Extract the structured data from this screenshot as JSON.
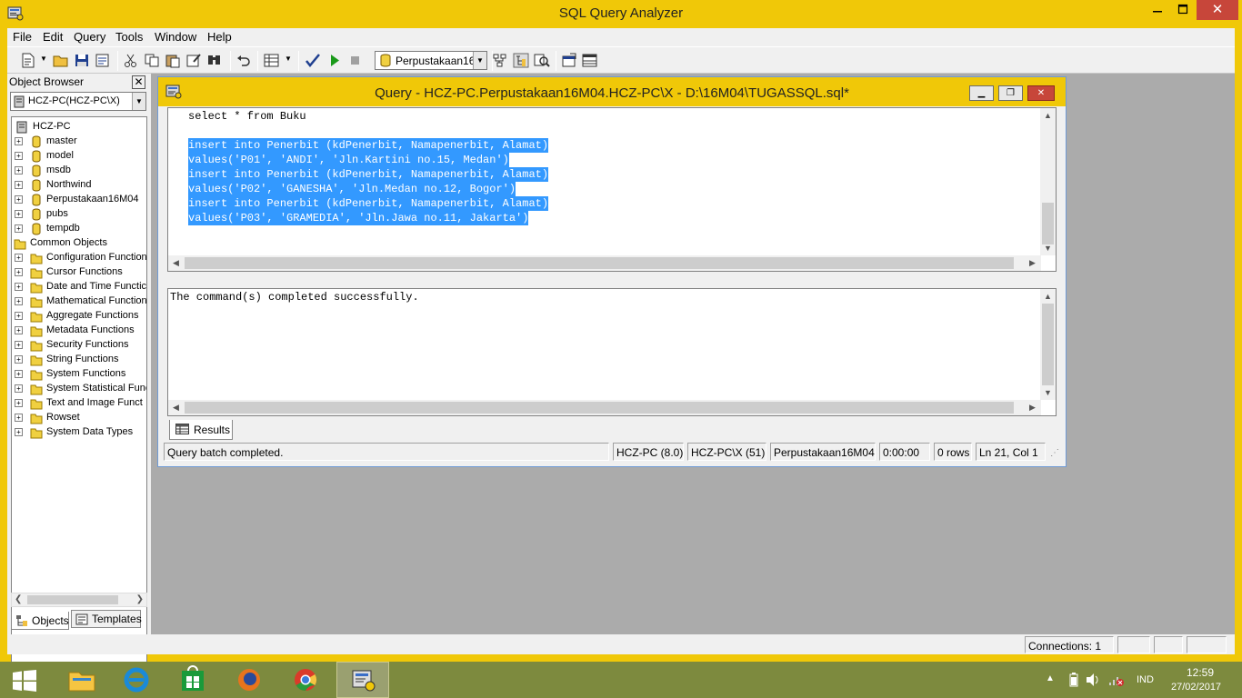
{
  "app": {
    "title": "SQL Query Analyzer"
  },
  "menu": {
    "items": [
      "File",
      "Edit",
      "Query",
      "Tools",
      "Window",
      "Help"
    ]
  },
  "toolbar": {
    "database": "Perpustakaan16"
  },
  "object_browser": {
    "title": "Object Browser",
    "close": "✕",
    "server_selector": "HCZ-PC(HCZ-PC\\X)",
    "root": "HCZ-PC",
    "databases": [
      "master",
      "model",
      "msdb",
      "Northwind",
      "Perpustakaan16M04",
      "pubs",
      "tempdb"
    ],
    "common_objects": "Common Objects",
    "function_groups": [
      "Configuration Function",
      "Cursor Functions",
      "Date and Time Functic",
      "Mathematical Function",
      "Aggregate Functions",
      "Metadata Functions",
      "Security Functions",
      "String Functions",
      "System Functions",
      "System Statistical Func",
      "Text and Image Funct",
      "Rowset",
      "System Data Types"
    ],
    "tabs": {
      "objects": "Objects",
      "templates": "Templates"
    }
  },
  "query_window": {
    "title": "Query - HCZ-PC.Perpustakaan16M04.HCZ-PC\\X - D:\\16M04\\TUGASSQL.sql*",
    "code_lines": [
      "select * from Buku",
      "",
      "insert into Penerbit (kdPenerbit, Namapenerbit, Alamat)",
      "values('P01', 'ANDI', 'Jln.Kartini no.15, Medan')",
      "insert into Penerbit (kdPenerbit, Namapenerbit, Alamat)",
      "values('P02', 'GANESHA', 'Jln.Medan no.12, Bogor')",
      "insert into Penerbit (kdPenerbit, Namapenerbit, Alamat)",
      "values('P03', 'GRAMEDIA', 'Jln.Jawa no.11, Jakarta')"
    ],
    "result_message": "The command(s) completed successfully.",
    "results_tab": "Results",
    "status": {
      "message": "Query batch completed.",
      "server": "HCZ-PC (8.0)",
      "user": "HCZ-PC\\X (51)",
      "database": "Perpustakaan16M04",
      "time": "0:00:00",
      "rows": "0 rows",
      "position": "Ln 21, Col 1"
    }
  },
  "app_status": {
    "connections": "Connections: 1"
  },
  "taskbar": {
    "language": "IND",
    "time": "12:59",
    "date": "27/02/2017"
  },
  "colors": {
    "window_frame": "#f0c808",
    "selection": "#3399ff",
    "close_button": "#c7463a",
    "workspace": "#ababab",
    "taskbar": "#7d8a3e"
  }
}
